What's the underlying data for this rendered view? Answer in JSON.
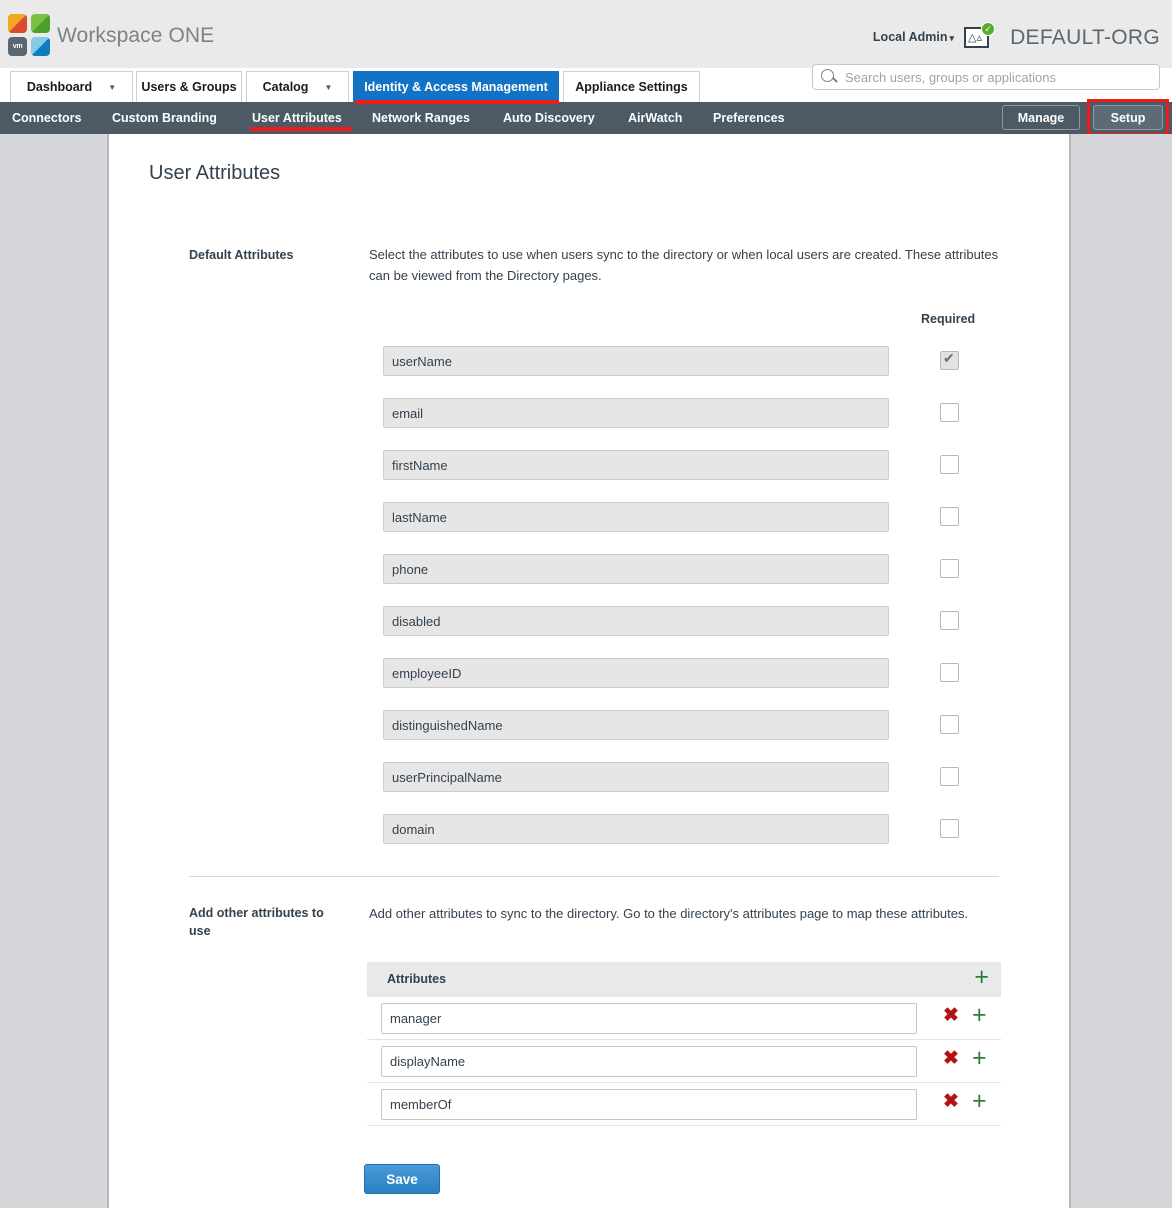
{
  "brand": {
    "product_name": "Workspace ONE",
    "logo_vm_label": "vm",
    "logo_colors": {
      "top_left": "#f4a521",
      "top_left_alt": "#d94b2b",
      "top_right": "#7cc242",
      "top_right_alt": "#4d9e2a",
      "bottom_left": "#5b6770",
      "bottom_right": "#86c9e8",
      "bottom_right_alt": "#0f7bc1"
    }
  },
  "header": {
    "account_label": "Local Admin",
    "account_caret": "▾",
    "org_icon_name": "org-analytics-icon",
    "org_icon_glyph": "✓",
    "org_name": "DEFAULT-ORG"
  },
  "search": {
    "placeholder": "Search users, groups or applications",
    "value": "",
    "icon": "search-icon"
  },
  "main_tabs": [
    {
      "id": "dashboard",
      "label": "Dashboard",
      "has_caret": true,
      "active": false
    },
    {
      "id": "users",
      "label": "Users & Groups",
      "has_caret": false,
      "active": false
    },
    {
      "id": "catalog",
      "label": "Catalog",
      "has_caret": true,
      "active": false
    },
    {
      "id": "iam",
      "label": "Identity & Access Management",
      "has_caret": false,
      "active": true
    },
    {
      "id": "appliance",
      "label": "Appliance Settings",
      "has_caret": false,
      "active": false
    }
  ],
  "sub_nav": {
    "items": [
      {
        "id": "connectors",
        "label": "Connectors",
        "active": false
      },
      {
        "id": "custom-branding",
        "label": "Custom Branding",
        "active": false
      },
      {
        "id": "user-attributes",
        "label": "User Attributes",
        "active": true
      },
      {
        "id": "network-ranges",
        "label": "Network Ranges",
        "active": false
      },
      {
        "id": "auto-discovery",
        "label": "Auto Discovery",
        "active": false
      },
      {
        "id": "airwatch",
        "label": "AirWatch",
        "active": false
      },
      {
        "id": "preferences",
        "label": "Preferences",
        "active": false
      }
    ],
    "manage_label": "Manage",
    "setup_label": "Setup"
  },
  "annotations": {
    "color": "#ee1b16",
    "boxed_element": "Setup",
    "underlined_elements": [
      "Identity & Access Management",
      "User Attributes"
    ]
  },
  "page": {
    "title": "User Attributes",
    "default_section": {
      "label": "Default Attributes",
      "description": "Select the attributes to use when users sync to the directory or when local users are created. These attributes can be viewed from the Directory pages.",
      "required_header": "Required",
      "rows": [
        {
          "name": "userName",
          "required": true
        },
        {
          "name": "email",
          "required": false
        },
        {
          "name": "firstName",
          "required": false
        },
        {
          "name": "lastName",
          "required": false
        },
        {
          "name": "phone",
          "required": false
        },
        {
          "name": "disabled",
          "required": false
        },
        {
          "name": "employeeID",
          "required": false
        },
        {
          "name": "distinguishedName",
          "required": false
        },
        {
          "name": "userPrincipalName",
          "required": false
        },
        {
          "name": "domain",
          "required": false
        }
      ]
    },
    "other_section": {
      "label": "Add other attributes to use",
      "description": "Add other attributes to sync to the directory. Go to the directory's attributes page to map these attributes.",
      "table_header": "Attributes",
      "add_icon": "+",
      "remove_icon": "✖",
      "rows": [
        {
          "name": "manager"
        },
        {
          "name": "displayName"
        },
        {
          "name": "memberOf"
        }
      ]
    },
    "save_label": "Save"
  }
}
